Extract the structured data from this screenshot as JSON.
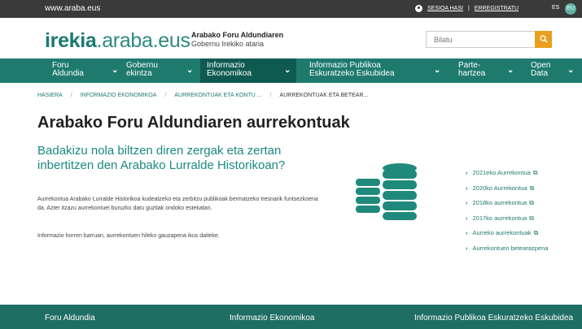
{
  "topbar": {
    "site": "www.araba.eus",
    "login": "SESIOA HASI",
    "separator": "|",
    "register": "ERREGISTRATU",
    "lang": "ES",
    "lang_active": "EU"
  },
  "header": {
    "logo_bold": "irekia",
    "logo_rest": ".araba.eus",
    "org_line1": "Arabako Foru Aldundiaren",
    "org_line2": "Gobernu Irekiko ataria",
    "search_placeholder": "Bilatu"
  },
  "nav": {
    "items": [
      {
        "l1": "Foru",
        "l2": "Aldundia"
      },
      {
        "l1": "Gobernu",
        "l2": "ekintza"
      },
      {
        "l1": "Informazio",
        "l2": "Ekonomikoa"
      },
      {
        "l1": "Informazio Publikoa",
        "l2": "Eskuratzeko Eskubidea"
      },
      {
        "l1": "Parte-",
        "l2": "hartzea"
      },
      {
        "l1": "Open",
        "l2": "Data"
      }
    ]
  },
  "breadcrumb": {
    "items": [
      "HASIERA",
      "INFORMAZIO EKONOMIKOA",
      "AURREKONTUAK ETA KONTU ...",
      "AURREKONTUAK ETA BETEAR..."
    ]
  },
  "main": {
    "title": "Arabako Foru Aldundiaren aurrekontuak",
    "lead": "Badakizu nola biltzen diren zergak eta zertan inbertitzen den Arabako Lurralde Historikoan?",
    "desc": "Aurrekontua Arabako Lurralde Historikoa kudeatzeko eta zerbitzu publikoak bermatzeko tresnarik funtsezkoena da. Azter itzazu aurrekontuei buruzko datu guztiak ondoko estekatan.",
    "note": "Informazio horren barruan, aurrekontuen hileko gauzapena ikus daiteke."
  },
  "links": [
    "2021eko Aurrekontua",
    "2020ko Aurrekontua",
    "2018ko aurrekontua",
    "2017ko aurrekontua",
    "Aurreko aurrekontuak",
    "Aurrekontuen betearazpena"
  ],
  "footer": {
    "col1": "Foru Aldundia",
    "col2": "Informazio Ekonomikoa",
    "col3": "Informazio Publikoa Eskuratzeko Eskubidea"
  },
  "colors": {
    "brand": "#1f7a6e",
    "accent": "#e8a020",
    "topbar": "#3a3a3a"
  },
  "icons": {
    "user": "user-icon",
    "search": "search-icon",
    "chevron": "chevron-down-icon",
    "arrow": "chevron-right-icon",
    "external": "external-link-icon",
    "coins": "coins-icon"
  }
}
